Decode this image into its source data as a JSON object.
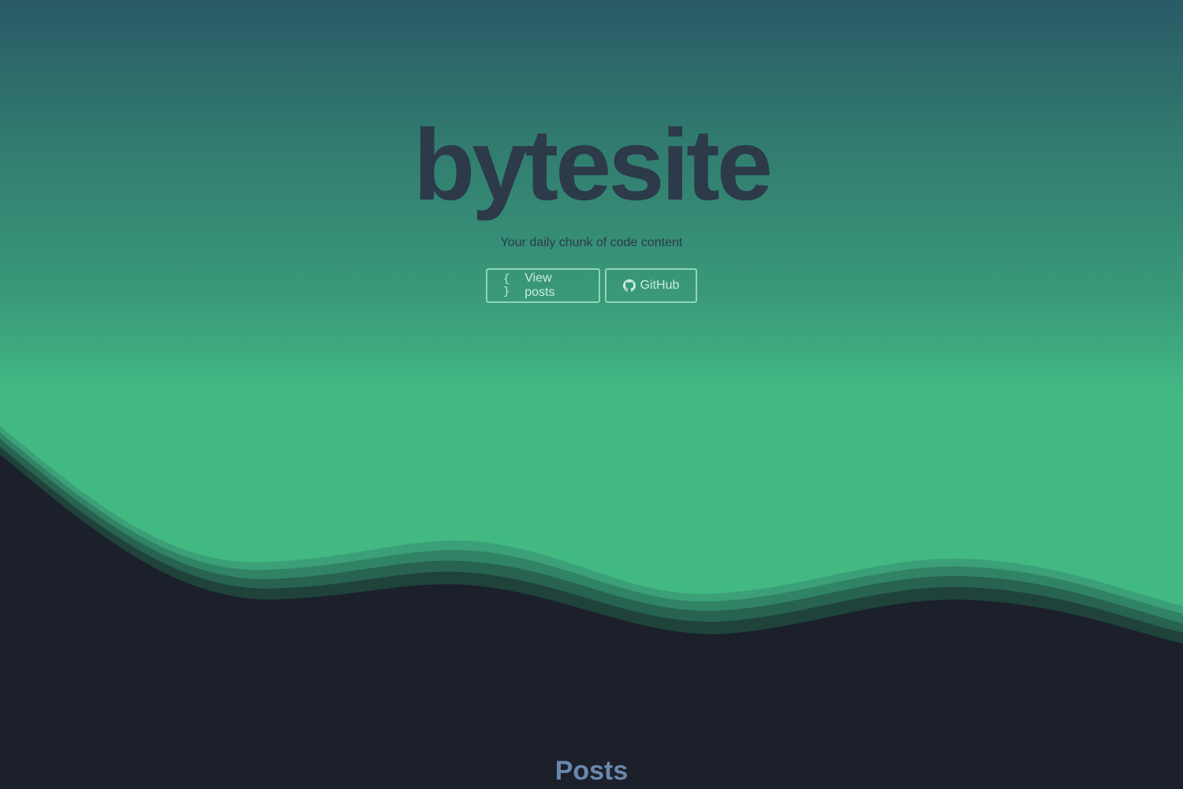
{
  "hero": {
    "title": "bytesite",
    "tagline": "Your daily chunk of code content"
  },
  "buttons": {
    "posts": {
      "icon": "braces-icon",
      "icon_text": "{ }",
      "label": "View posts"
    },
    "github": {
      "icon": "github-icon",
      "label": "GitHub"
    }
  },
  "sections": {
    "posts_heading": "Posts"
  },
  "colors": {
    "accent": "#42b983",
    "dark": "#1b202b",
    "title": "#2c3a4a",
    "heading": "#6b87ad"
  }
}
